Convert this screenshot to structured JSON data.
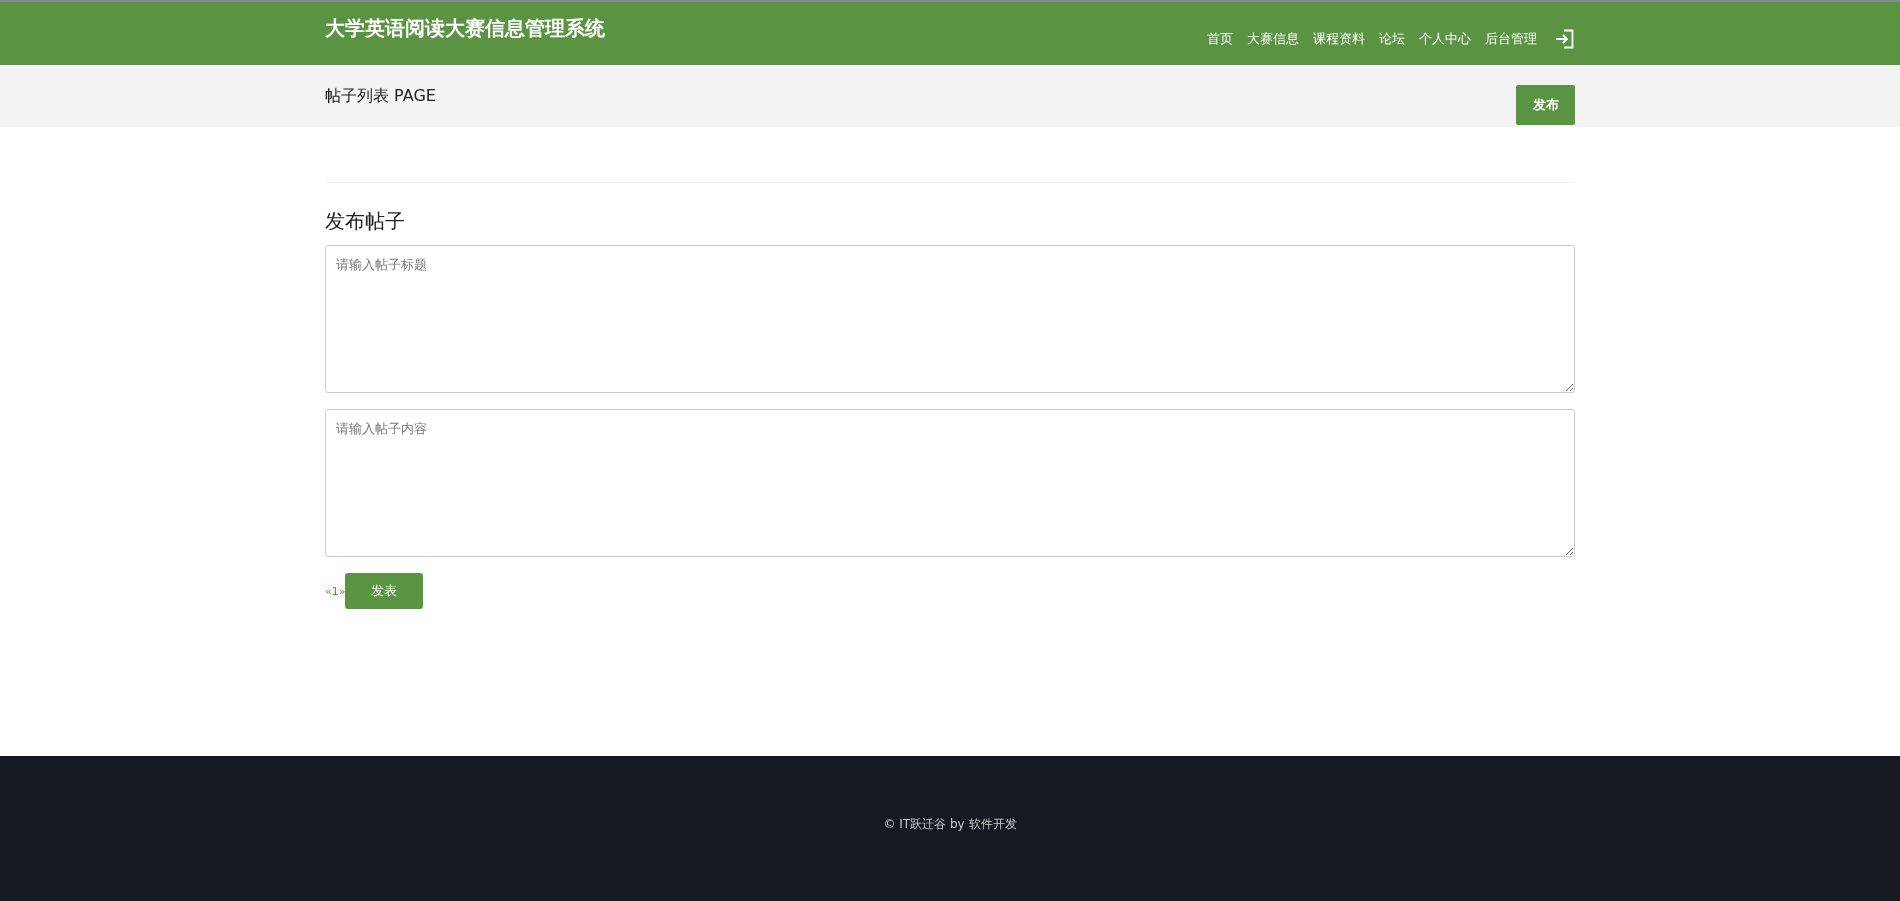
{
  "header": {
    "title": "大学英语阅读大赛信息管理系统",
    "nav": [
      {
        "label": "首页"
      },
      {
        "label": "大赛信息"
      },
      {
        "label": "课程资料"
      },
      {
        "label": "论坛"
      },
      {
        "label": "个人中心"
      },
      {
        "label": "后台管理"
      }
    ]
  },
  "subheader": {
    "title": "帖子列表 PAGE",
    "button": "发布"
  },
  "form": {
    "heading": "发布帖子",
    "title_field": {
      "placeholder": "请输入帖子标题"
    },
    "content_field": {
      "placeholder": "请输入帖子内容"
    },
    "pager": "«1»",
    "submit": "发表"
  },
  "footer": {
    "text": "© IT跃迁谷 by 软件开发"
  }
}
